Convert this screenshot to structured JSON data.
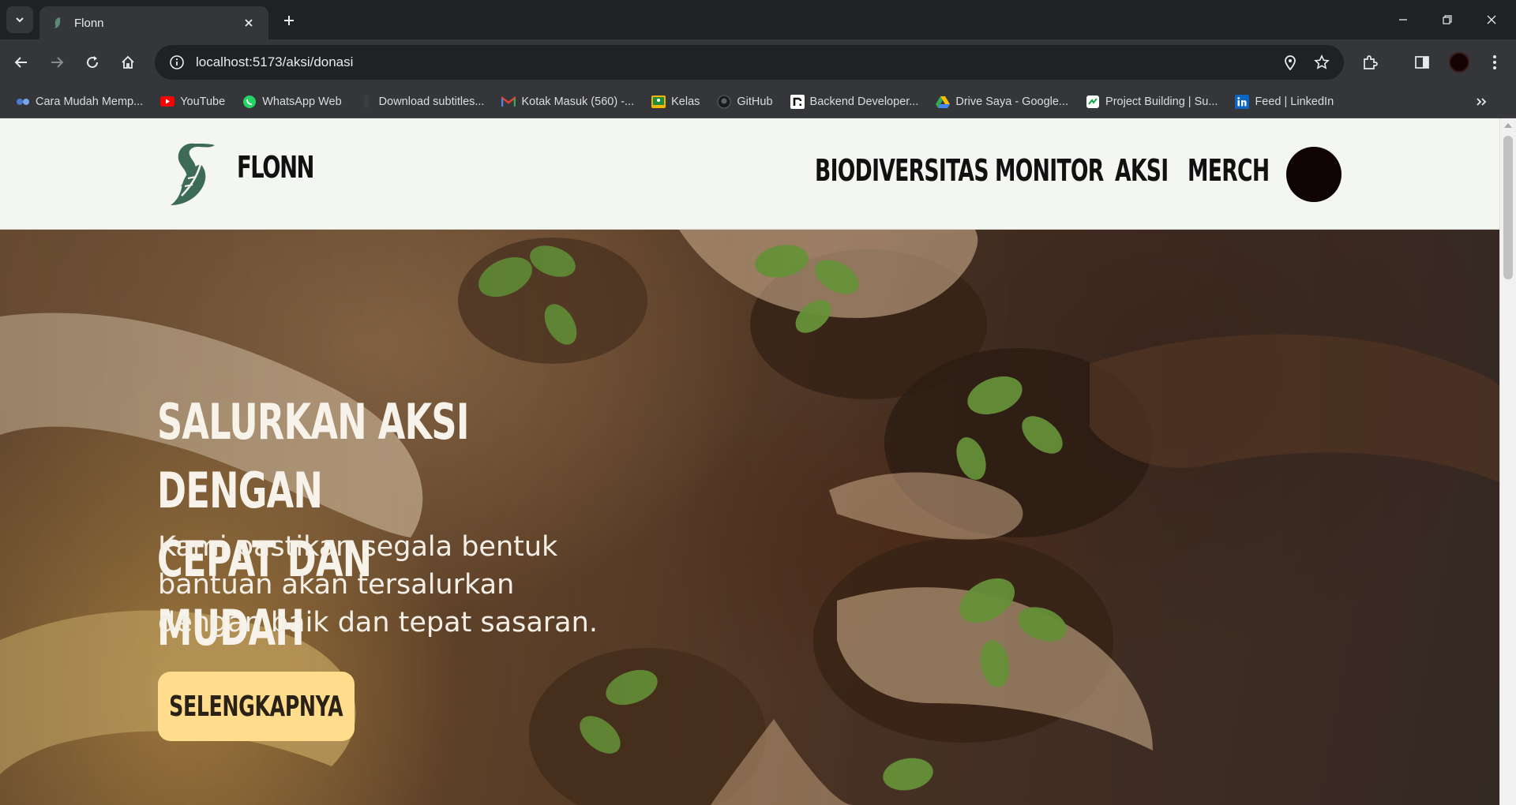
{
  "browser": {
    "tab_title": "Flonn",
    "url": "localhost:5173/aksi/donasi",
    "bookmarks": [
      {
        "label": "Cara Mudah Memp...",
        "icon": "link-icon"
      },
      {
        "label": "YouTube",
        "icon": "youtube-icon"
      },
      {
        "label": "WhatsApp Web",
        "icon": "whatsapp-icon"
      },
      {
        "label": "Download subtitles...",
        "icon": "page-icon"
      },
      {
        "label": "Kotak Masuk (560) -...",
        "icon": "gmail-icon"
      },
      {
        "label": "Kelas",
        "icon": "classroom-icon"
      },
      {
        "label": "GitHub",
        "icon": "github-icon"
      },
      {
        "label": "Backend Developer...",
        "icon": "dicoding-icon"
      },
      {
        "label": "Drive Saya - Google...",
        "icon": "drive-icon"
      },
      {
        "label": "Project Building | Su...",
        "icon": "project-icon"
      },
      {
        "label": "Feed | LinkedIn",
        "icon": "linkedin-icon"
      }
    ]
  },
  "site": {
    "brand": "FLONN",
    "nav": [
      "BIODIVERSITAS",
      "MONITOR",
      "AKSI",
      "MERCH"
    ],
    "brand_color": "#3e6b57"
  },
  "hero": {
    "title": "SALURKAN AKSI DENGAN\nCEPAT DAN MUDAH",
    "subtitle": "Kami pastikan segala bentuk\nbantuan akan tersalurkan\ndengan baik dan tepat sasaran.",
    "cta_label": "SELENGKAPNYA",
    "cta_color": "#ffdd8c"
  }
}
